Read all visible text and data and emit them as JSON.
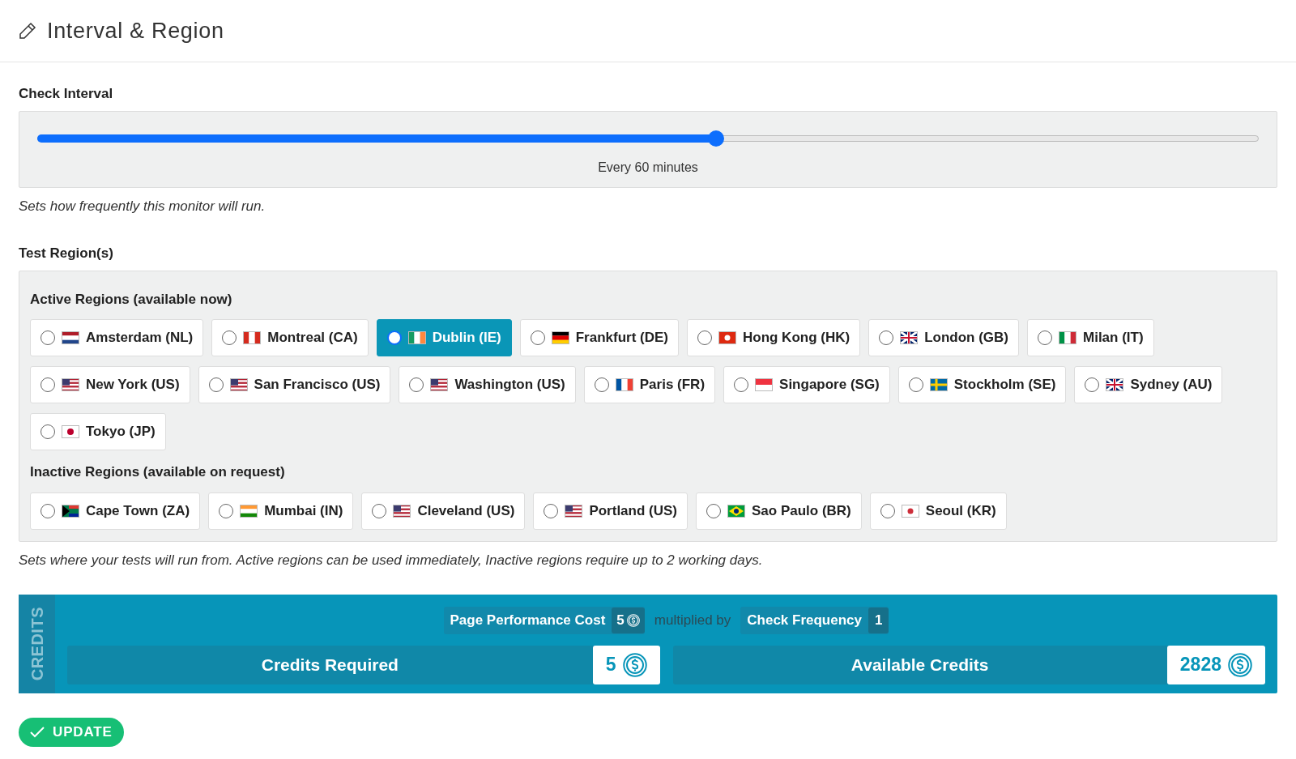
{
  "header": {
    "title": "Interval & Region"
  },
  "check_interval": {
    "label": "Check Interval",
    "level": 0.556,
    "reading": "Every 60 minutes",
    "help": "Sets how frequently this monitor will run."
  },
  "test_regions": {
    "label": "Test Region(s)",
    "groups": [
      {
        "heading": "Active Regions (available now)",
        "regions": [
          {
            "name": "Amsterdam (NL)",
            "selected": false
          },
          {
            "name": "Montreal (CA)",
            "selected": false
          },
          {
            "name": "Dublin (IE)",
            "selected": true
          },
          {
            "name": "Frankfurt (DE)",
            "selected": false
          },
          {
            "name": "Hong Kong (HK)",
            "selected": false
          },
          {
            "name": "London (GB)",
            "selected": false
          },
          {
            "name": "Milan (IT)",
            "selected": false
          },
          {
            "name": "New York (US)",
            "selected": false
          },
          {
            "name": "San Francisco (US)",
            "selected": false
          },
          {
            "name": "Washington (US)",
            "selected": false
          },
          {
            "name": "Paris (FR)",
            "selected": false
          },
          {
            "name": "Singapore (SG)",
            "selected": false
          },
          {
            "name": "Stockholm (SE)",
            "selected": false
          },
          {
            "name": "Sydney (AU)",
            "selected": false
          },
          {
            "name": "Tokyo (JP)",
            "selected": false
          }
        ]
      },
      {
        "heading": "Inactive Regions (available on request)",
        "regions": [
          {
            "name": "Cape Town (ZA)",
            "selected": false
          },
          {
            "name": "Mumbai (IN)",
            "selected": false
          },
          {
            "name": "Cleveland (US)",
            "selected": false
          },
          {
            "name": "Portland (US)",
            "selected": false
          },
          {
            "name": "Sao Paulo (BR)",
            "selected": false
          },
          {
            "name": "Seoul (KR)",
            "selected": false
          }
        ]
      }
    ],
    "help": "Sets where your tests will run from. Active regions can be used immediately, Inactive regions require up to 2 working days."
  },
  "credits": {
    "tab": "CREDITS",
    "cost_label": "Page Performance Cost",
    "cost_value": "5",
    "multiplier": "multiplied by",
    "frequency_label": "Check Frequency",
    "frequency_value": "1",
    "required_label": "Credits Required",
    "required_value": "5",
    "available_label": "Available Credits",
    "available_value": "2828"
  },
  "update_button": "UPDATE"
}
